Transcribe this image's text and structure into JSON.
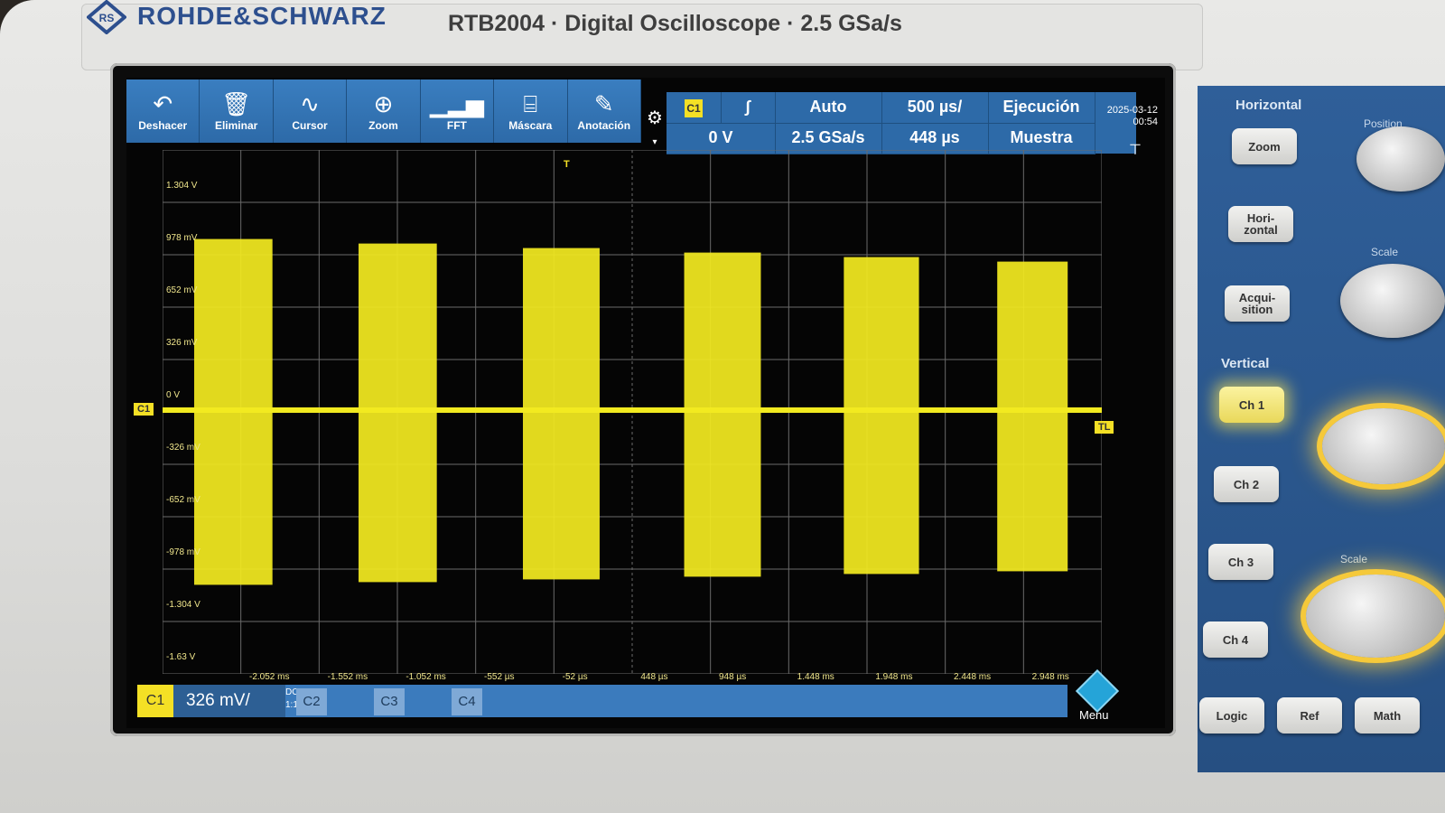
{
  "header": {
    "brand": "ROHDE&SCHWARZ",
    "model": "RTB2004 · Digital Oscilloscope · 2.5 GSa/s"
  },
  "toolbar": {
    "items": [
      {
        "label": "Deshacer",
        "icon": "undo-icon"
      },
      {
        "label": "Eliminar",
        "icon": "trash-icon"
      },
      {
        "label": "Cursor",
        "icon": "cursor-icon"
      },
      {
        "label": "Zoom",
        "icon": "zoom-icon"
      },
      {
        "label": "FFT",
        "icon": "fft-icon"
      },
      {
        "label": "Máscara",
        "icon": "mask-icon"
      },
      {
        "label": "Anotación",
        "icon": "pencil-icon"
      }
    ]
  },
  "status": {
    "trigger_source": "C1",
    "trigger_level": "0 V",
    "trigger_mode": "Auto",
    "sample_rate": "2.5 GSa/s",
    "time_scale": "500 µs/",
    "time_position": "448 µs",
    "run_state": "Ejecución",
    "acq_mode": "Muestra",
    "date": "2025-03-12",
    "time": "00:54"
  },
  "y_axis_labels": [
    "1.304 V",
    "978 mV",
    "652 mV",
    "326 mV",
    "0 V",
    "-326 mV",
    "-652 mV",
    "-978 mV",
    "-1.304 V",
    "-1.63 V"
  ],
  "x_axis_labels": [
    "-2.052 ms",
    "-1.552 ms",
    "-1.052 ms",
    "-552 µs",
    "-52 µs",
    "448 µs",
    "948 µs",
    "1.448 ms",
    "1.948 ms",
    "2.448 ms",
    "2.948 ms"
  ],
  "markers": {
    "channel": "C1",
    "trigger": "T",
    "trigger_level": "TL"
  },
  "channels": {
    "c1_label": "C1",
    "c1_scale": "326 mV/",
    "c1_coupling": "DC",
    "c1_probe": "1:1",
    "c2_label": "C2",
    "c3_label": "C3",
    "c4_label": "C4"
  },
  "menu_label": "Menu",
  "panel": {
    "horizontal_title": "Horizontal",
    "position_label": "Position",
    "scale_label": "Scale",
    "zoom_button": "Zoom",
    "horizontal_button": "Hori-\nzontal",
    "acquisition_button": "Acqui-\nsition",
    "vertical_title": "Vertical",
    "ch1_button": "Ch 1",
    "ch2_button": "Ch 2",
    "ch3_button": "Ch 3",
    "ch4_button": "Ch 4",
    "logic_button": "Logic",
    "ref_button": "Ref",
    "math_button": "Math"
  },
  "trace": {
    "color": "#f2ea20",
    "bursts": [
      {
        "start_ms": -2.35,
        "end_ms": -1.85
      },
      {
        "start_ms": -1.3,
        "end_ms": -0.8
      },
      {
        "start_ms": -0.25,
        "end_ms": 0.24
      },
      {
        "start_ms": 0.78,
        "end_ms": 1.27
      },
      {
        "start_ms": 1.8,
        "end_ms": 2.28
      },
      {
        "start_ms": 2.78,
        "end_ms": 3.23
      }
    ]
  }
}
